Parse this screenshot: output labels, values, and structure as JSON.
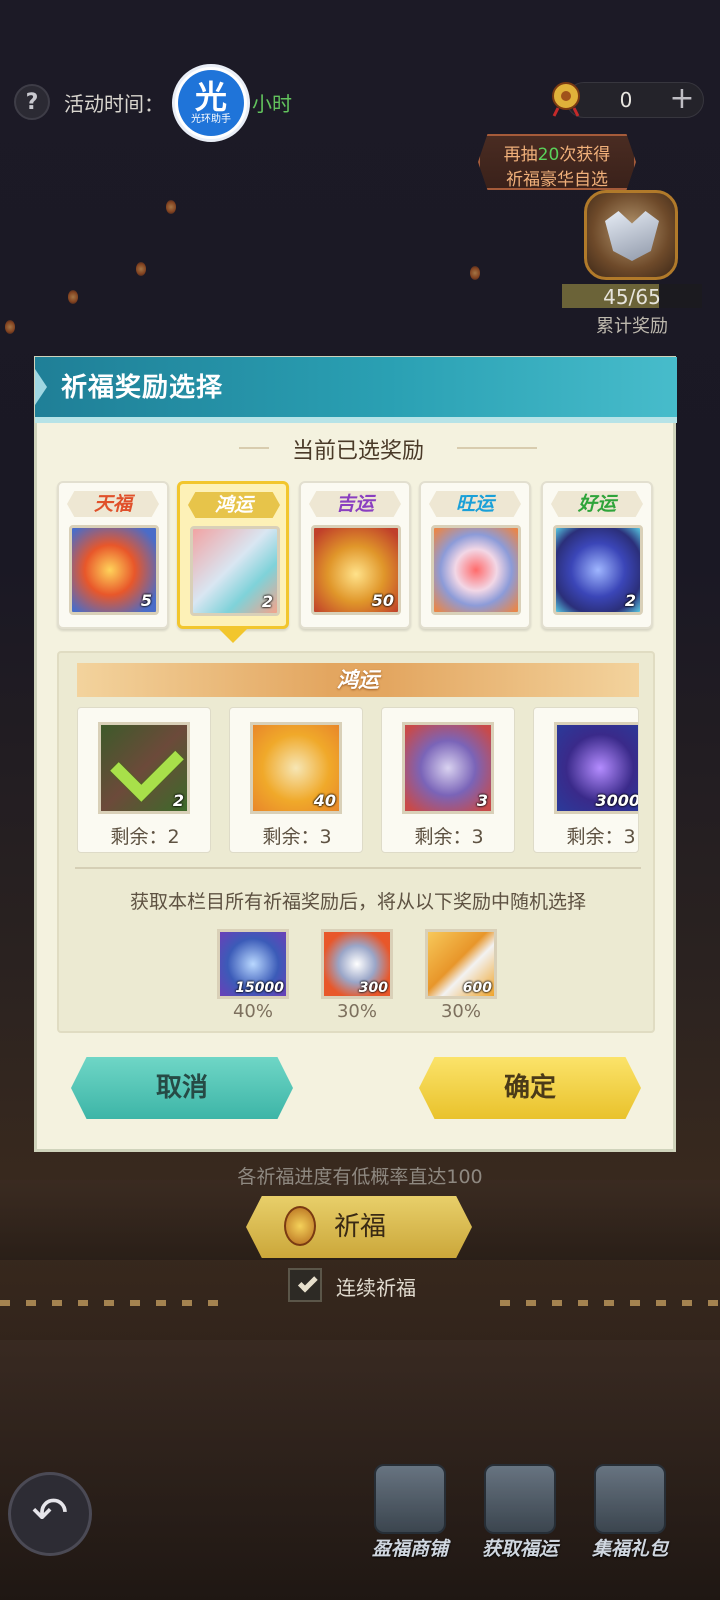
{
  "top_bar": {
    "help_icon": "question-mark-icon",
    "event_time_label": "活动时间：",
    "event_time_suffix": "小时",
    "watermark_char": "光",
    "watermark_text": "光环助手",
    "currency_value": "0",
    "plus_label": "+"
  },
  "draw_banner": {
    "prefix": "再抽",
    "count": "20",
    "suffix": "次获得",
    "line2": "祈福豪华自选"
  },
  "cumulative_reward": {
    "progress_text": "45/65",
    "progress_fraction": 0.692,
    "label": "累计奖励"
  },
  "modal": {
    "title": "祈福奖励选择",
    "current_selected_label": "当前已选奖励",
    "tiers": [
      {
        "label": "天福",
        "color": "#e0502a",
        "count": "5",
        "icon": "fire-creature-icon",
        "selected": false
      },
      {
        "label": "鸿运",
        "color": "#ffffff",
        "count": "2",
        "icon": "axe-weapon-icon",
        "selected": true
      },
      {
        "label": "吉运",
        "color": "#8a3fc0",
        "count": "50",
        "icon": "golden-armor-icon",
        "selected": false
      },
      {
        "label": "旺运",
        "color": "#1aa0d8",
        "count": "",
        "icon": "gem-box-icon",
        "selected": false
      },
      {
        "label": "好运",
        "color": "#2fa43a",
        "count": "2",
        "icon": "hex-crystal-icon",
        "selected": false
      }
    ],
    "pool": {
      "header": "鸿运",
      "items": [
        {
          "count": "2",
          "remain": "剩余：2",
          "icon": "axe-claimed-icon",
          "claimed": true
        },
        {
          "count": "40",
          "remain": "剩余：3",
          "icon": "golden-pedestal-icon",
          "claimed": false
        },
        {
          "count": "3",
          "remain": "剩余：3",
          "icon": "purple-star-icon",
          "claimed": false
        },
        {
          "count": "3000",
          "remain": "剩余：3",
          "icon": "purple-scroll-icon",
          "claimed": false
        }
      ],
      "random_text": "获取本栏目所有祈福奖励后，将从以下奖励中随机选择",
      "random_items": [
        {
          "count": "15000",
          "percent": "40%",
          "icon": "blue-crystal-icon"
        },
        {
          "count": "300",
          "percent": "30%",
          "icon": "silver-star-icon"
        },
        {
          "count": "600",
          "percent": "30%",
          "icon": "silver-blade-icon"
        }
      ]
    },
    "cancel_label": "取消",
    "confirm_label": "确定"
  },
  "below": {
    "probability_note": "各祈福进度有低概率直达100",
    "pray_label": "祈福",
    "continuous_label": "连续祈福",
    "continuous_checked": true
  },
  "bottom_nav": [
    {
      "label": "盈福商铺",
      "icon": "shop-chest-icon"
    },
    {
      "label": "获取福运",
      "icon": "card-book-icon"
    },
    {
      "label": "集福礼包",
      "icon": "gift-box-icon"
    }
  ],
  "colors": {
    "header_teal": "#2aa0b3",
    "selected_gold": "#f2c62d",
    "pool_orange": "#e3a660",
    "cancel_teal": "#3db5a7",
    "confirm_yellow": "#e9c22c"
  }
}
